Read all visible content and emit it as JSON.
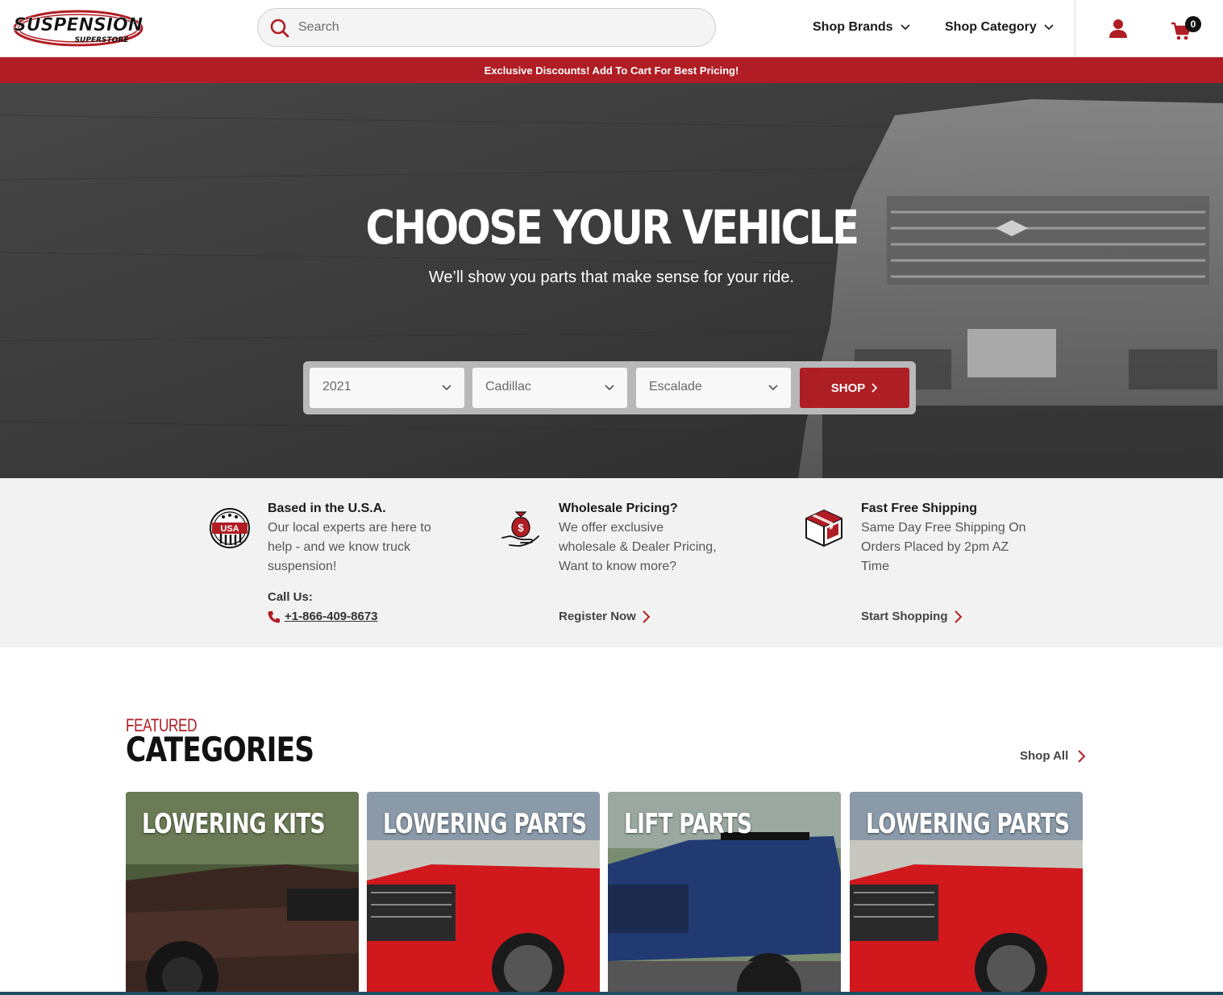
{
  "header": {
    "logo_text": "SUSPENSION",
    "logo_subtext": "SUPERSTORE",
    "search_placeholder": "Search",
    "nav": [
      {
        "label": "Shop Brands"
      },
      {
        "label": "Shop Category"
      }
    ],
    "cart_count": "0",
    "icons": [
      "search-icon",
      "chevron-down-icon",
      "user-icon",
      "cart-icon"
    ]
  },
  "promo": {
    "text": "Exclusive Discounts! Add To Cart For Best Pricing!"
  },
  "hero": {
    "title": "CHOOSE YOUR VEHICLE",
    "subtitle": "We’ll show you parts that make sense for your ride.",
    "year": "2021",
    "make": "Cadillac",
    "model": "Escalade",
    "shop_label": "SHOP"
  },
  "features": [
    {
      "icon": "usa-badge-icon",
      "badge_text": "USA",
      "title": "Based in the U.S.A.",
      "text_lines": [
        "Our local experts are here to",
        "help - and we know truck",
        "suspension!"
      ],
      "call_label": "Call Us:",
      "phone": "+1-866-409-8673"
    },
    {
      "icon": "money-bag-icon",
      "title": "Wholesale Pricing?",
      "text_lines": [
        "We offer exclusive",
        "wholesale & Dealer Pricing,",
        "Want to know more?"
      ],
      "link": "Register Now"
    },
    {
      "icon": "box-icon",
      "title": "Fast Free Shipping",
      "text_lines": [
        "Same Day Free Shipping On",
        "Orders Placed by 2pm AZ",
        "Time"
      ],
      "link": "Start Shopping"
    }
  ],
  "categories": {
    "eyebrow": "FEATURED",
    "heading": "CATEGORIES",
    "shop_all": "Shop All",
    "cards": [
      {
        "label": "LOWERING KITS"
      },
      {
        "label": "LOWERING PARTS"
      },
      {
        "label": "LIFT PARTS"
      },
      {
        "label": "LOWERING PARTS"
      }
    ]
  },
  "colors": {
    "brand_red": "#b11d24",
    "hero_bg": "#3b3b3b",
    "feature_bg": "#f2f2f2"
  }
}
